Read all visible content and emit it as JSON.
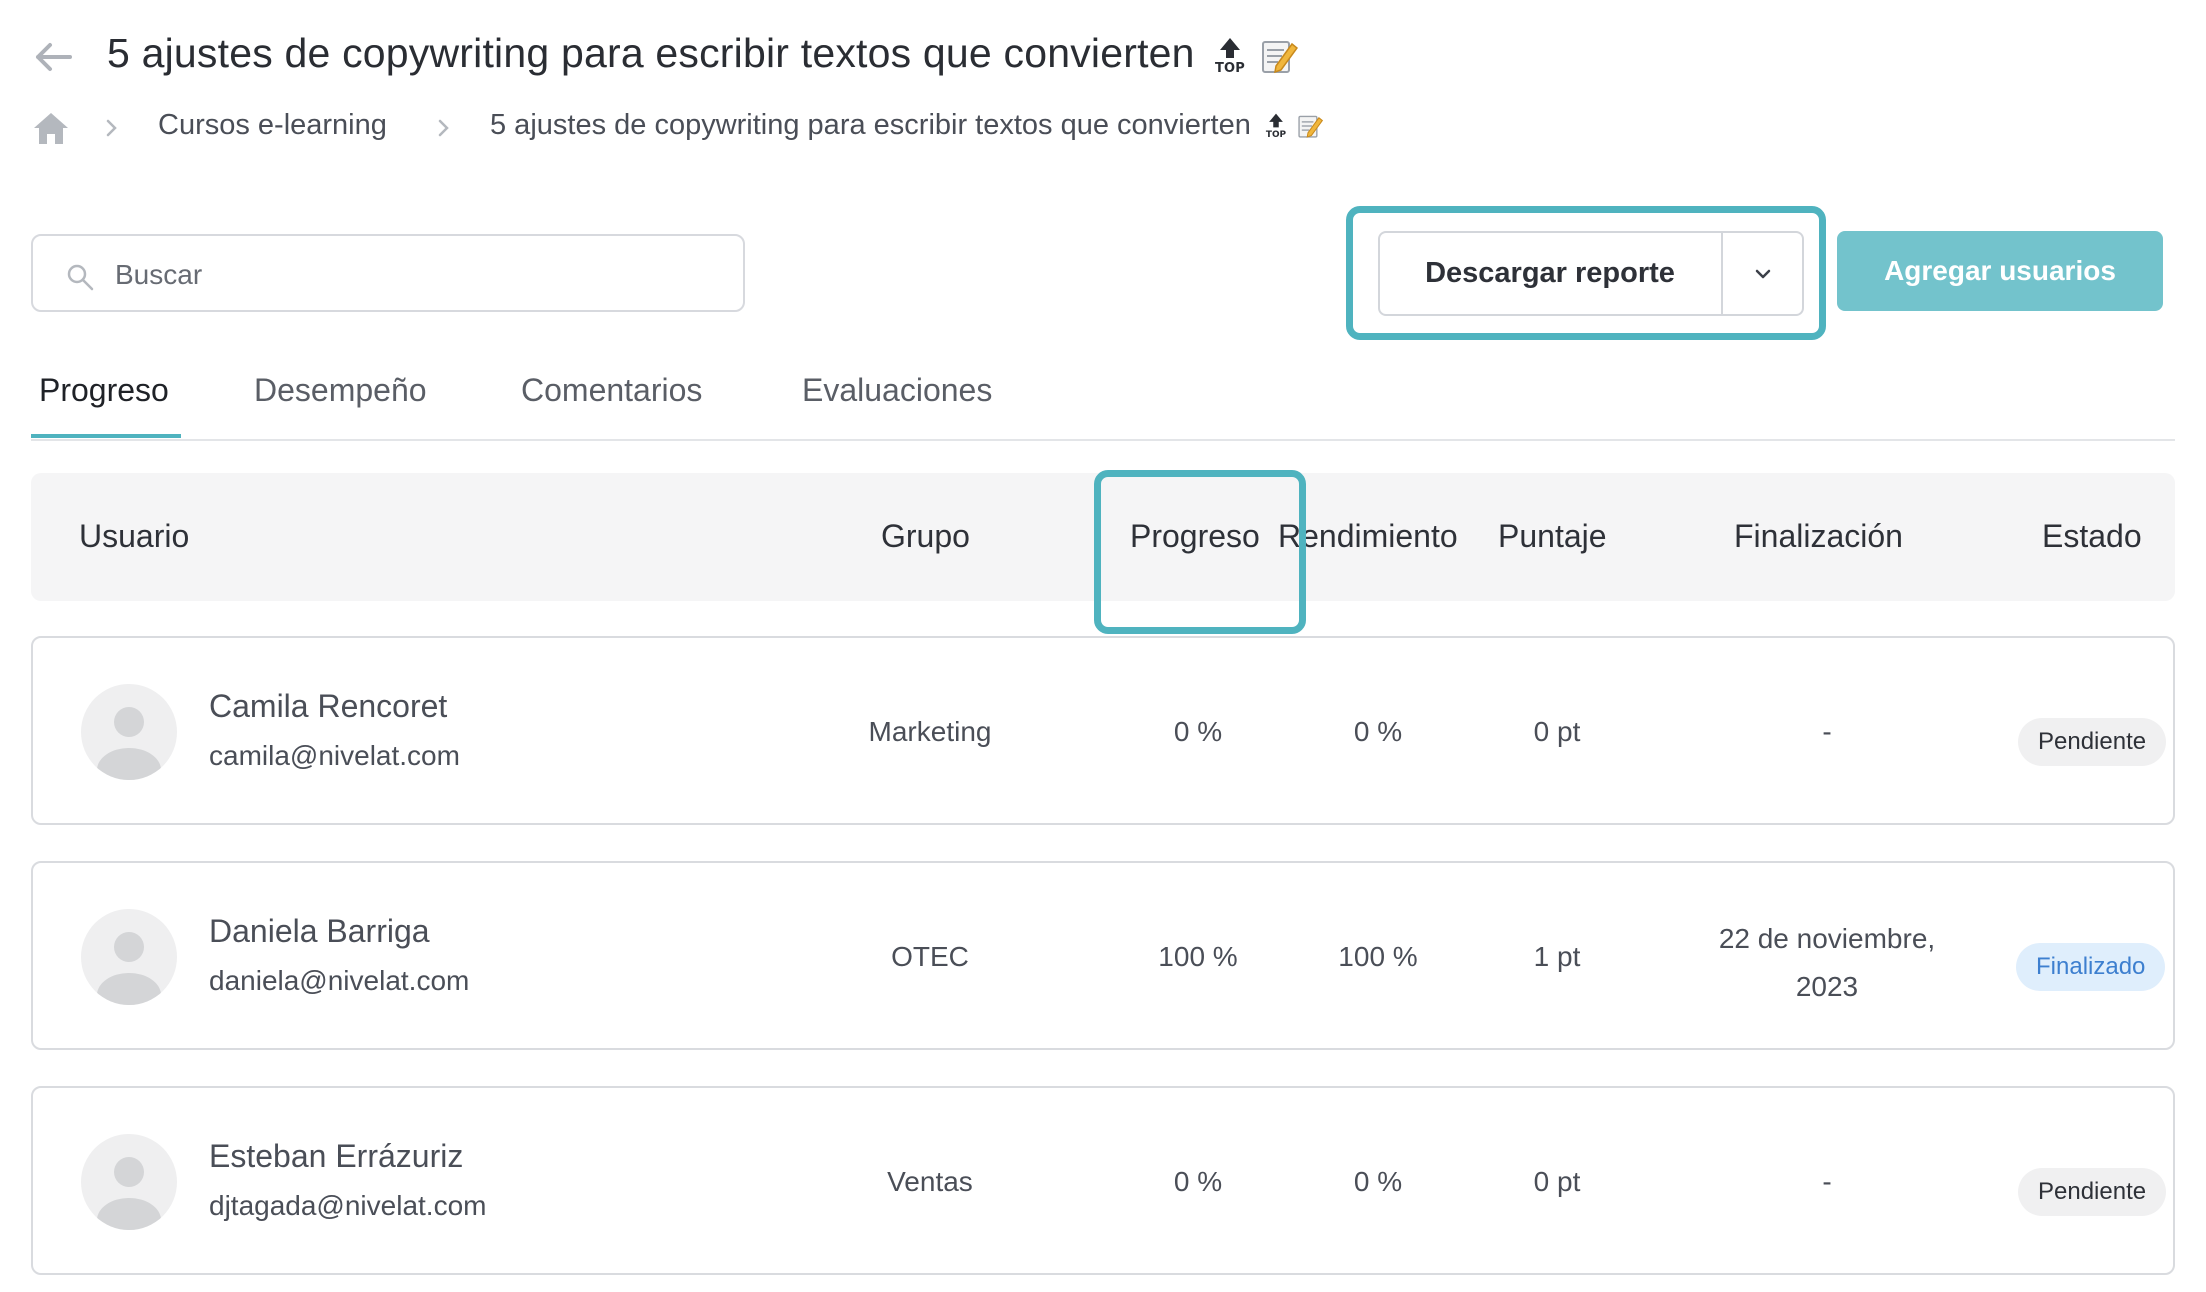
{
  "header": {
    "title": "5 ajustes de copywriting para escribir textos que convierten"
  },
  "breadcrumb": {
    "items": [
      "Cursos e-learning",
      "5 ajustes de copywriting para escribir textos que convierten"
    ]
  },
  "toolbar": {
    "search_placeholder": "Buscar",
    "download_label": "Descargar reporte",
    "add_users_label": "Agregar usuarios"
  },
  "tabs": [
    {
      "label": "Progreso",
      "active": true
    },
    {
      "label": "Desempeño",
      "active": false
    },
    {
      "label": "Comentarios",
      "active": false
    },
    {
      "label": "Evaluaciones",
      "active": false
    }
  ],
  "table": {
    "columns": [
      "Usuario",
      "Grupo",
      "Progreso",
      "Rendimiento",
      "Puntaje",
      "Finalización",
      "Estado"
    ],
    "rows": [
      {
        "name": "Camila Rencoret",
        "email": "camila@nivelat.com",
        "group": "Marketing",
        "progress": "0 %",
        "performance": "0 %",
        "score": "0 pt",
        "completion_line1": "-",
        "completion_line2": "",
        "status": "Pendiente"
      },
      {
        "name": "Daniela Barriga",
        "email": "daniela@nivelat.com",
        "group": "OTEC",
        "progress": "100 %",
        "performance": "100 %",
        "score": "1 pt",
        "completion_line1": "22 de noviembre,",
        "completion_line2": "2023",
        "status": "Finalizado"
      },
      {
        "name": "Esteban Errázuriz",
        "email": "djtagada@nivelat.com",
        "group": "Ventas",
        "progress": "0 %",
        "performance": "0 %",
        "score": "0 pt",
        "completion_line1": "-",
        "completion_line2": "",
        "status": "Pendiente"
      }
    ]
  },
  "colors": {
    "accent": "#4fb3bf",
    "primary_button": "#73c3cc",
    "badge_done_bg": "#dfeefc",
    "badge_done_text": "#3d7fcf",
    "badge_pending_bg": "#f0f0f1"
  },
  "icons": {
    "back": "arrow-left-icon",
    "home": "home-icon",
    "separator": "chevron-right-icon",
    "search": "search-icon",
    "caret": "chevron-down-icon",
    "avatar": "user-avatar-icon",
    "emoji_top": "top-arrow-emoji",
    "emoji_memo": "memo-emoji"
  }
}
